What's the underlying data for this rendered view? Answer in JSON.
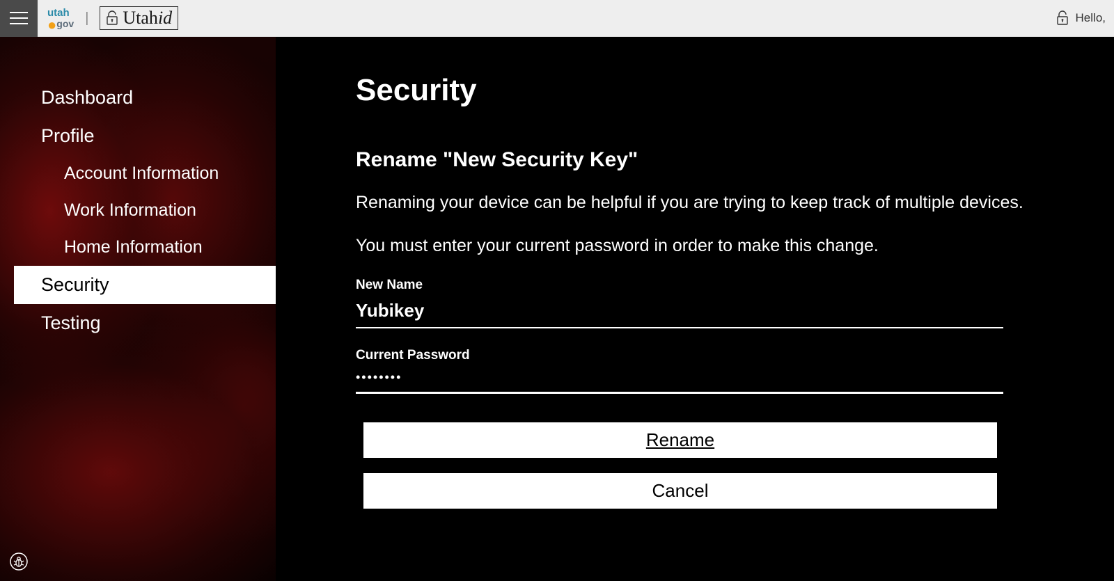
{
  "topbar": {
    "logo_utah": "utah",
    "logo_gov": "gov",
    "brand_text_utah": "Utah",
    "brand_text_id": "id",
    "hello": "Hello,"
  },
  "sidebar": {
    "items": [
      {
        "label": "Dashboard",
        "sub": false,
        "active": false
      },
      {
        "label": "Profile",
        "sub": false,
        "active": false
      },
      {
        "label": "Account Information",
        "sub": true,
        "active": false
      },
      {
        "label": "Work Information",
        "sub": true,
        "active": false
      },
      {
        "label": "Home Information",
        "sub": true,
        "active": false
      },
      {
        "label": "Security",
        "sub": false,
        "active": true
      },
      {
        "label": "Testing",
        "sub": false,
        "active": false
      }
    ]
  },
  "main": {
    "heading": "Security",
    "subheading": "Rename \"New Security Key\"",
    "help1": "Renaming your device can be helpful if you are trying to keep track of multiple devices.",
    "help2": "You must enter your current password in order to make this change.",
    "new_name_label": "New Name",
    "new_name_value": "Yubikey",
    "current_password_label": "Current Password",
    "current_password_value": "••••••••",
    "rename_btn": "Rename",
    "cancel_btn": "Cancel"
  }
}
